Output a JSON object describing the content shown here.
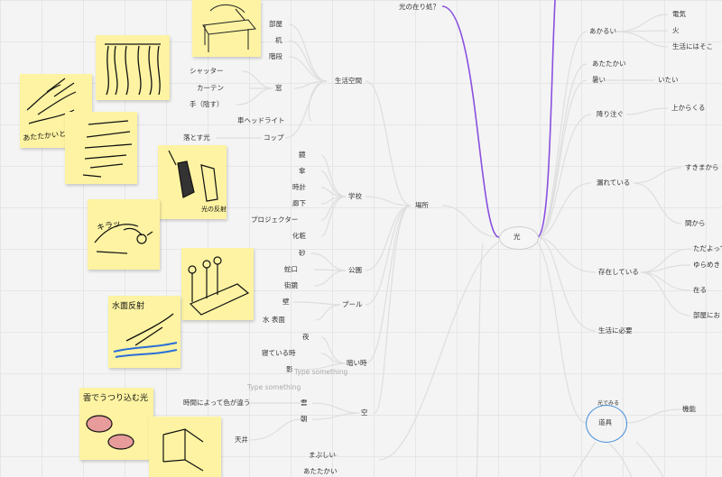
{
  "center": "光",
  "root_top": "光の在り処？",
  "branch_place": "場所",
  "left": {
    "living_space": {
      "label": "生活空間",
      "items": [
        "部屋",
        "机",
        "階段",
        "窓",
        "車ヘッドライト",
        "コップ"
      ]
    },
    "window_items": [
      "シャッター",
      "カーテン",
      "手（陰す）"
    ],
    "falling_light": "落とす光",
    "school": {
      "label": "学校",
      "items": [
        "鏡",
        "傘",
        "時計",
        "廊下",
        "プロジェクター",
        "化粧"
      ]
    },
    "park": {
      "label": "公園",
      "items": [
        "砂",
        "蛇口",
        "街鏡"
      ]
    },
    "pool": {
      "label": "プール",
      "items": [
        "壁",
        "水 表面"
      ]
    },
    "dark_time": {
      "label": "暗い時",
      "items": [
        "夜",
        "寝ている時",
        "影"
      ]
    },
    "sky": {
      "label": "空",
      "items": [
        "雲",
        "朝"
      ]
    },
    "color_by_time": "時間によって色が違う",
    "ceiling": "天井",
    "placeholders": [
      "Type something",
      "Type something"
    ],
    "bottom_items": [
      "まぶしい",
      "あたたかい"
    ]
  },
  "right": {
    "bright": {
      "label": "あかるい",
      "items": [
        "電気",
        "火",
        "生活にはそこ"
      ]
    },
    "warm": "あたたかい",
    "hot": {
      "label": "暑い",
      "items": [
        "いたい"
      ]
    },
    "pour": {
      "label": "降り注ぐ",
      "items": [
        "上からくる"
      ]
    },
    "leak": {
      "label": "漏れている",
      "items": [
        "すきまから",
        "間から"
      ]
    },
    "exist": {
      "label": "存在している",
      "items": [
        "ただよって",
        "ゆらめき",
        "在る",
        "部屋にお"
      ]
    },
    "necessary": "生活に必要",
    "tool": {
      "caption": "光でみる",
      "label": "道具",
      "items": [
        "機能"
      ]
    }
  },
  "notes": {
    "hand_note": "あたたかいときは手で目を覆う",
    "kira": "キラッ",
    "shadow": "影",
    "sui": "水面反射",
    "cloud": "雲でうつり込む光",
    "light_label": "光の反射"
  },
  "colors": {
    "purple": "#8a4fe0",
    "link": "#dedede",
    "note": "#fdf3a2",
    "tool_circle": "#4a90d9"
  }
}
